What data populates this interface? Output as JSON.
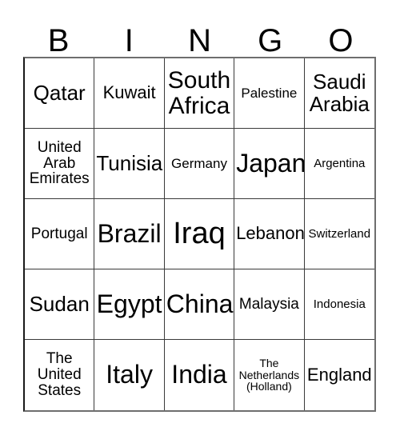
{
  "card": {
    "title": "BINGO",
    "header_letters": [
      "B",
      "I",
      "N",
      "G",
      "O"
    ],
    "columns": 5,
    "rows": 5,
    "border_color": "#3a3a3a",
    "background_color": "#ffffff",
    "text_color": "#000000",
    "cells": [
      [
        {
          "text": "Qatar",
          "size": "fs-md"
        },
        {
          "text": "Kuwait",
          "size": "fs-sm"
        },
        {
          "text": "South\nAfrica",
          "size": "fs-lg"
        },
        {
          "text": "Palestine",
          "size": "fs-xxs"
        },
        {
          "text": "Saudi\nArabia",
          "size": "fs-md"
        }
      ],
      [
        {
          "text": "United\nArab\nEmirates",
          "size": "fs-xs"
        },
        {
          "text": "Tunisia",
          "size": "fs-md"
        },
        {
          "text": "Germany",
          "size": "fs-xxs"
        },
        {
          "text": "Japan",
          "size": "fs-xl"
        },
        {
          "text": "Argentina",
          "size": "fs-tiny"
        }
      ],
      [
        {
          "text": "Portugal",
          "size": "fs-xs"
        },
        {
          "text": "Brazil",
          "size": "fs-xl"
        },
        {
          "text": "Iraq",
          "size": "fs-xxl"
        },
        {
          "text": "Lebanon",
          "size": "fs-sm"
        },
        {
          "text": "Switzerland",
          "size": "fs-tiny"
        }
      ],
      [
        {
          "text": "Sudan",
          "size": "fs-md"
        },
        {
          "text": "Egypt",
          "size": "fs-xl"
        },
        {
          "text": "China",
          "size": "fs-xl"
        },
        {
          "text": "Malaysia",
          "size": "fs-xs"
        },
        {
          "text": "Indonesia",
          "size": "fs-tiny"
        }
      ],
      [
        {
          "text": "The\nUnited\nStates",
          "size": "fs-xs"
        },
        {
          "text": "Italy",
          "size": "fs-xl"
        },
        {
          "text": "India",
          "size": "fs-xl"
        },
        {
          "text": "The\nNetherlands\n(Holland)",
          "size": "fs-mini"
        },
        {
          "text": "England",
          "size": "fs-sm"
        }
      ]
    ]
  }
}
